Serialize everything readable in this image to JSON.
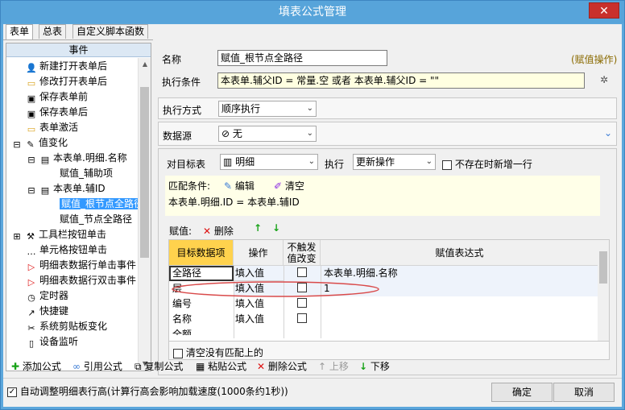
{
  "window": {
    "title": "填表公式管理",
    "close": "✕"
  },
  "tabs": [
    "表单",
    "总表",
    "自定义脚本函数"
  ],
  "left": {
    "header": "事件",
    "items": [
      "新建打开表单后",
      "修改打开表单后",
      "保存表单前",
      "保存表单后",
      "表单激活",
      "值变化",
      "本表单.明细.名称",
      "赋值_辅助项",
      "本表单.辅ID",
      "赋值_根节点全路径",
      "赋值_节点全路径",
      "工具栏按钮单击",
      "单元格按钮单击",
      "明细表数据行单击事件",
      "明细表数据行双击事件",
      "定时器",
      "快捷键",
      "系统剪贴板变化",
      "设备监听"
    ]
  },
  "form": {
    "name_label": "名称",
    "name_value": "赋值_根节点全路径",
    "assign_hint": "(赋值操作)",
    "condition_label": "执行条件",
    "condition_value": "本表单.辅父ID  = 常量.空  或者  本表单.辅父ID  =  \"\"",
    "exec_mode_label": "执行方式",
    "exec_mode_value": "顺序执行",
    "datasource_label": "数据源",
    "datasource_value": "无",
    "target_label": "对目标表",
    "target_value": "明细",
    "exec_label": "执行",
    "exec_value": "更新操作",
    "insert_label": "不存在时新增一行",
    "match_label": "匹配条件:",
    "edit_label": "编辑",
    "clear_label": "清空",
    "match_expr": "本表单.明细.ID  =  本表单.辅ID",
    "assign_label": "赋值:",
    "delete_label": "删除",
    "grid_headers": [
      "目标数据项",
      "操作",
      "不触发值改变",
      "赋值表达式"
    ],
    "grid_rows": [
      [
        "全路径",
        "填入值",
        "",
        "本表单.明细.名称"
      ],
      [
        "层",
        "填入值",
        "",
        "1"
      ],
      [
        "编号",
        "填入值",
        "",
        ""
      ],
      [
        "名称",
        "填入值",
        "",
        ""
      ],
      [
        "全额",
        "",
        "",
        ""
      ]
    ],
    "clear_unmatched": "清空没有匹配上的"
  },
  "bottom": {
    "add": "添加公式",
    "ref": "引用公式",
    "copy": "复制公式",
    "paste": "粘贴公式",
    "del": "删除公式",
    "up": "上移",
    "down": "下移",
    "auto_adjust": "自动调整明细表行高(计算行高会影响加载速度(1000条约1秒))",
    "ok": "确定",
    "cancel": "取消"
  }
}
